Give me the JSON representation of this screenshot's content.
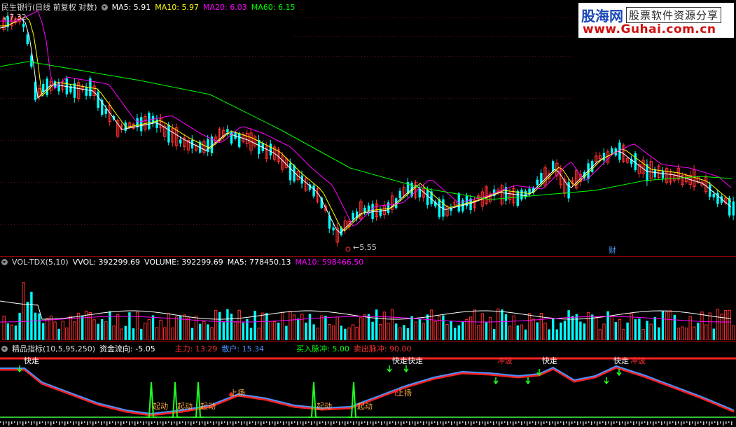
{
  "logo": {
    "name": "股海网",
    "tag": "股票软件资源分享",
    "url": "www.Guhai.com.cn"
  },
  "price_pane": {
    "title": "民生银行(日线 前复权 对数)",
    "ma5": "MA5: 5.91",
    "ma10": "MA10: 5.97",
    "ma20": "MA20: 6.03",
    "ma60": "MA60: 6.15",
    "high_label": "7.32",
    "low_label": "5.55",
    "finance_mark": "财",
    "colors": {
      "ma5": "#ffffff",
      "ma10": "#ffff00",
      "ma20": "#ff00ff",
      "ma60": "#00ff00",
      "up": "#ff3030",
      "down": "#00ffff"
    }
  },
  "volume_pane": {
    "title": "VOL-TDX(5,10)",
    "vvol": "VVOL: 392299.69",
    "volume": "VOLUME: 392299.69",
    "ma5": "MA5: 778450.13",
    "ma10": "MA10: 598466.50"
  },
  "indicator_pane": {
    "title": "精品指标(10,5,95,250)",
    "flow": "资金流向: -5.05",
    "main": "主力: 13.29",
    "retail": "散户: 15.34",
    "buy": "买入脉冲: 5.00",
    "sell": "卖出脉冲: 90.00",
    "signals": {
      "quick": "快走",
      "quick2": "快走快走",
      "rush": "冲波",
      "start": "起动",
      "rise": "上扬",
      "jie": "快走",
      "chongbo": "冲波"
    }
  }
}
